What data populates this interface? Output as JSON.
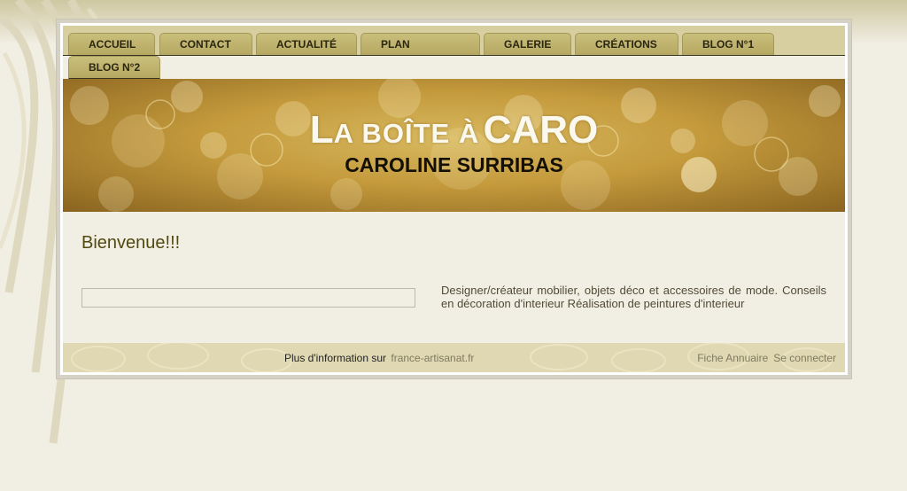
{
  "nav": {
    "tabs": [
      {
        "id": "accueil",
        "label": "ACCUEIL"
      },
      {
        "id": "contact",
        "label": "CONTACT"
      },
      {
        "id": "actualite",
        "label": "ACTUALITÉ"
      },
      {
        "id": "plan",
        "label": "PLAN"
      },
      {
        "id": "galerie",
        "label": "GALERIE"
      },
      {
        "id": "creations",
        "label": "CRÉATIONS"
      },
      {
        "id": "blog1",
        "label": "BLOG N°1"
      },
      {
        "id": "blog2",
        "label": "BLOG N°2"
      }
    ]
  },
  "banner": {
    "title_l": "L",
    "title_mid": "A BOÎTE À",
    "title_caro": "CARO",
    "subtitle": "CAROLINE SURRIBAS"
  },
  "content": {
    "welcome": "Bienvenue!!!",
    "description": "Designer/créateur mobilier, objets déco et accessoires de mode. Conseils en décoration d'interieur Réalisation de peintures d'interieur"
  },
  "footer": {
    "info_prefix": "Plus d'information sur",
    "info_link": "france-artisanat.fr",
    "annuaire_link": "Fiche Annuaire",
    "login_link": "Se connecter"
  },
  "colors": {
    "page_bg": "#f1eee3",
    "nav_bar": "#d7cf9f",
    "tab": "#c2b670",
    "heading": "#514910",
    "footer_bg": "#e0d8b2",
    "link": "#807a60"
  },
  "icons": [
    "bokeh-banner-pattern",
    "swirl-background-pattern"
  ]
}
